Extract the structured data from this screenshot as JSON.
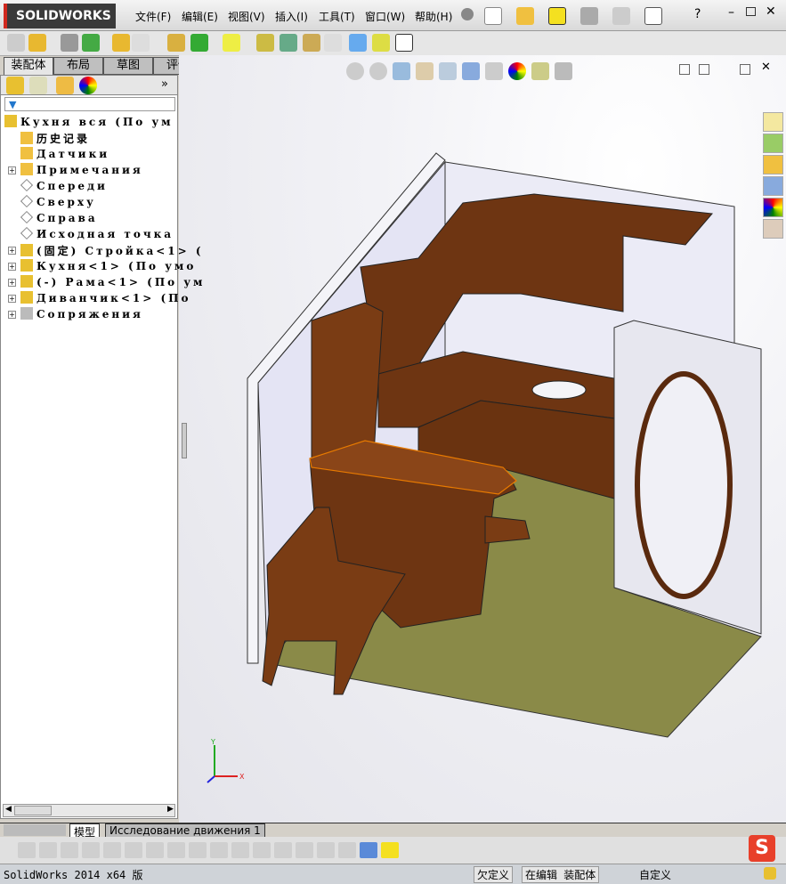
{
  "app": {
    "logo": "SOLIDWORKS",
    "version_status": "SolidWorks 2014 x64 版"
  },
  "menu": [
    "文件(F)",
    "编辑(E)",
    "视图(V)",
    "插入(I)",
    "工具(T)",
    "窗口(W)",
    "帮助(H)"
  ],
  "cmd_tabs": [
    "装配体",
    "布局",
    "草图",
    "评估"
  ],
  "active_cmd_tab": 0,
  "tree": {
    "root": "Кухня вся (По ум",
    "items": [
      {
        "label": "历史记录",
        "expand": false
      },
      {
        "label": "Датчики",
        "expand": false
      },
      {
        "label": "Примечания",
        "expand": true
      },
      {
        "label": "Спереди",
        "expand": false
      },
      {
        "label": "Сверху",
        "expand": false
      },
      {
        "label": "Справа",
        "expand": false
      },
      {
        "label": "Исходная точка",
        "expand": false
      },
      {
        "label": "(固定) Стройка<1> (",
        "expand": true
      },
      {
        "label": "Кухня<1> (По умо",
        "expand": true
      },
      {
        "label": "(-) Рама<1> (По ум",
        "expand": true
      },
      {
        "label": "Диванчик<1> (По",
        "expand": true
      },
      {
        "label": "Сопряжения",
        "expand": true
      }
    ]
  },
  "bottom_tabs": [
    "模型",
    "Исследование движения 1"
  ],
  "status": {
    "definition": "欠定义",
    "editing": "在编辑 装配体",
    "units": "自定义"
  },
  "triad": {
    "x": "X",
    "y": "Y"
  },
  "colors": {
    "wood": "#6e3512",
    "floor": "#8a8a48",
    "wall": "#e9e9f5",
    "accent": "#d0281e"
  }
}
